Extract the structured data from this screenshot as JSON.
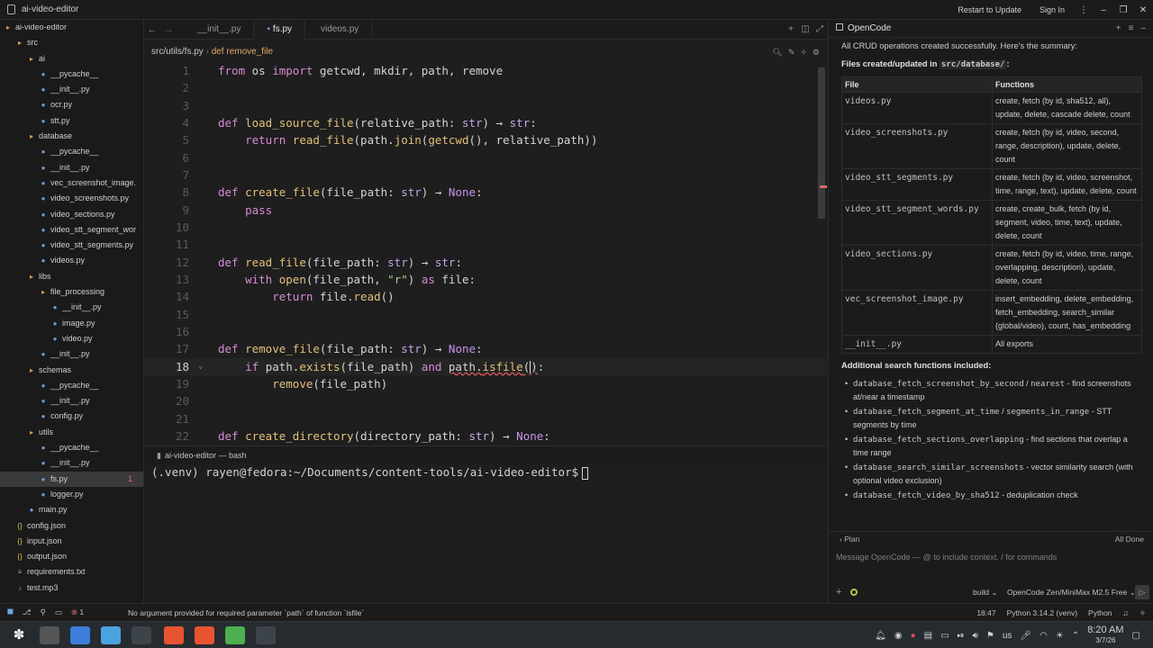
{
  "window": {
    "title": "ai-video-editor",
    "restart_label": "Restart to Update",
    "signin_label": "Sign In"
  },
  "sidebar": {
    "items": [
      {
        "label": "ai-video-editor",
        "depth": 0,
        "kind": "folder"
      },
      {
        "label": "src",
        "depth": 1,
        "kind": "folder"
      },
      {
        "label": "ai",
        "depth": 2,
        "kind": "folder"
      },
      {
        "label": "__pycache__",
        "depth": 3,
        "kind": "py"
      },
      {
        "label": "__init__.py",
        "depth": 3,
        "kind": "py"
      },
      {
        "label": "ocr.py",
        "depth": 3,
        "kind": "py"
      },
      {
        "label": "stt.py",
        "depth": 3,
        "kind": "py"
      },
      {
        "label": "database",
        "depth": 2,
        "kind": "folder"
      },
      {
        "label": "__pycache__",
        "depth": 3,
        "kind": "py"
      },
      {
        "label": "__init__.py",
        "depth": 3,
        "kind": "py"
      },
      {
        "label": "vec_screenshot_image.",
        "depth": 3,
        "kind": "py"
      },
      {
        "label": "video_screenshots.py",
        "depth": 3,
        "kind": "py"
      },
      {
        "label": "video_sections.py",
        "depth": 3,
        "kind": "py"
      },
      {
        "label": "video_stt_segment_wor",
        "depth": 3,
        "kind": "py"
      },
      {
        "label": "video_stt_segments.py",
        "depth": 3,
        "kind": "py"
      },
      {
        "label": "videos.py",
        "depth": 3,
        "kind": "py"
      },
      {
        "label": "libs",
        "depth": 2,
        "kind": "folder"
      },
      {
        "label": "file_processing",
        "depth": 3,
        "kind": "folder"
      },
      {
        "label": "__init__.py",
        "depth": 4,
        "kind": "py"
      },
      {
        "label": "image.py",
        "depth": 4,
        "kind": "py"
      },
      {
        "label": "video.py",
        "depth": 4,
        "kind": "py"
      },
      {
        "label": "__init__.py",
        "depth": 3,
        "kind": "py"
      },
      {
        "label": "schemas",
        "depth": 2,
        "kind": "folder"
      },
      {
        "label": "__pycache__",
        "depth": 3,
        "kind": "py"
      },
      {
        "label": "__init__.py",
        "depth": 3,
        "kind": "py"
      },
      {
        "label": "config.py",
        "depth": 3,
        "kind": "py"
      },
      {
        "label": "utils",
        "depth": 2,
        "kind": "folder"
      },
      {
        "label": "__pycache__",
        "depth": 3,
        "kind": "py"
      },
      {
        "label": "__init__.py",
        "depth": 3,
        "kind": "py"
      },
      {
        "label": "fs.py",
        "depth": 3,
        "kind": "py",
        "selected": true,
        "badge": "1"
      },
      {
        "label": "logger.py",
        "depth": 3,
        "kind": "py"
      },
      {
        "label": "main.py",
        "depth": 2,
        "kind": "py"
      },
      {
        "label": "config.json",
        "depth": 1,
        "kind": "json"
      },
      {
        "label": "input.json",
        "depth": 1,
        "kind": "json"
      },
      {
        "label": "output.json",
        "depth": 1,
        "kind": "json"
      },
      {
        "label": "requirements.txt",
        "depth": 1,
        "kind": "txt"
      },
      {
        "label": "test.mp3",
        "depth": 1,
        "kind": "mp3"
      }
    ]
  },
  "editor": {
    "tabs": [
      "__init__.py",
      "fs.py",
      "videos.py"
    ],
    "active_tab": 1,
    "breadcrumb_path": "src/utils/fs.py",
    "breadcrumb_symbol": "def remove_file",
    "current_line": 18,
    "lines": [
      {
        "n": "1",
        "html": "<span class='k'>from</span> os <span class='k'>import</span> getcwd, mkdir, path, remove"
      },
      {
        "n": "2",
        "html": ""
      },
      {
        "n": "3",
        "html": ""
      },
      {
        "n": "4",
        "html": "<span class='k'>def</span> <span class='f'>load_source_file</span>(relative_path: <span class='t'>str</span>) <span class='op'>→</span> <span class='t'>str</span>:"
      },
      {
        "n": "5",
        "html": "    <span class='k'>return</span> <span class='f'>read_file</span>(path.<span class='f'>join</span>(<span class='f'>getcwd</span>(), relative_path))"
      },
      {
        "n": "6",
        "html": ""
      },
      {
        "n": "7",
        "html": ""
      },
      {
        "n": "8",
        "html": "<span class='k'>def</span> <span class='f'>create_file</span>(file_path: <span class='t'>str</span>) <span class='op'>→</span> <span class='c-none'>None</span>:"
      },
      {
        "n": "9",
        "html": "    <span class='k'>pass</span>"
      },
      {
        "n": "10",
        "html": ""
      },
      {
        "n": "11",
        "html": ""
      },
      {
        "n": "12",
        "html": "<span class='k'>def</span> <span class='f'>read_file</span>(file_path: <span class='t'>str</span>) <span class='op'>→</span> <span class='t'>str</span>:"
      },
      {
        "n": "13",
        "html": "    <span class='k'>with</span> <span class='f'>open</span>(file_path, <span class='s'>\"r\"</span>) <span class='k'>as</span> file:"
      },
      {
        "n": "14",
        "html": "        <span class='k'>return</span> file.<span class='f'>read</span>()"
      },
      {
        "n": "15",
        "html": ""
      },
      {
        "n": "16",
        "html": ""
      },
      {
        "n": "17",
        "html": "<span class='k'>def</span> <span class='f'>remove_file</span>(file_path: <span class='t'>str</span>) <span class='op'>→</span> <span class='c-none'>None</span>:"
      },
      {
        "n": "18",
        "html": "    <span class='k'>if</span> path.<span class='f'>exists</span>(file_path) <span class='k'>and</span> <span class='err'>path.<span class='f'>isfile</span>(</span><span class='cursor'></span><span class='err'>)</span>:"
      },
      {
        "n": "19",
        "html": "        <span class='f'>remove</span>(file_path)"
      },
      {
        "n": "20",
        "html": ""
      },
      {
        "n": "21",
        "html": ""
      },
      {
        "n": "22",
        "html": "<span class='k'>def</span> <span class='f'>create_directory</span>(directory_path: <span class='t'>str</span>) <span class='op'>→</span> <span class='c-none'>None</span>:"
      }
    ]
  },
  "terminal": {
    "tab_label": "ai-video-editor — bash",
    "prompt": "(.venv) rayen@fedora:~/Documents/content-tools/ai-video-editor$"
  },
  "panel": {
    "title": "OpenCode",
    "intro": "All CRUD operations created successfully. Here's the summary:",
    "files_heading_prefix": "Files created/updated in ",
    "files_heading_code": "src/database/",
    "files_heading_suffix": ":",
    "table_headers": [
      "File",
      "Functions"
    ],
    "table_rows": [
      [
        "videos.py",
        "create, fetch (by id, sha512, all), update, delete, cascade delete, count"
      ],
      [
        "video_screenshots.py",
        "create, fetch (by id, video, second, range, description), update, delete, count"
      ],
      [
        "video_stt_segments.py",
        "create, fetch (by id, video, screenshot, time, range, text), update, delete, count"
      ],
      [
        "video_stt_segment_words.py",
        "create, create_bulk, fetch (by id, segment, video, time, text), update, delete, count"
      ],
      [
        "video_sections.py",
        "create, fetch (by id, video, time, range, overlapping, description), update, delete, count"
      ],
      [
        "vec_screenshot_image.py",
        "insert_embedding, delete_embedding, fetch_embedding, search_similar (global/video), count, has_embedding"
      ],
      [
        "__init__.py",
        "All exports"
      ]
    ],
    "search_heading": "Additional search functions included:",
    "bullets": [
      {
        "code": [
          "database_fetch_screenshot_by_second",
          "nearest"
        ],
        "sep": " / ",
        "text": " - find screenshots at/near a timestamp"
      },
      {
        "code": [
          "database_fetch_segment_at_time",
          "segments_in_range"
        ],
        "sep": " / ",
        "text": " - STT segments by time"
      },
      {
        "code": [
          "database_fetch_sections_overlapping"
        ],
        "sep": "",
        "text": " - find sections that overlap a time range"
      },
      {
        "code": [
          "database_search_similar_screenshots"
        ],
        "sep": "",
        "text": " - vector similarity search (with optional video exclusion)"
      },
      {
        "code": [
          "database_fetch_video_by_sha512"
        ],
        "sep": "",
        "text": " - deduplication check"
      }
    ],
    "plan_label": "Plan",
    "plan_status": "All Done",
    "input_placeholder": "Message OpenCode — @ to include context, / for commands",
    "mode": "build",
    "model": "OpenCode Zen/MiniMax M2.5 Free"
  },
  "statusbar": {
    "diagnostics": "1",
    "message": "No argument provided for required parameter `path` of function `isfile`",
    "position": "18:47",
    "interpreter": "Python 3.14.2 (venv)",
    "language": "Python"
  },
  "taskbar": {
    "time": "8:20 AM",
    "date": "3/7/26",
    "keyboard": "us"
  },
  "colors": {
    "keyword": "#d68ad4",
    "function": "#e5c07b",
    "type": "#c4a7e7",
    "string": "#a6d189",
    "error": "#e05555"
  }
}
